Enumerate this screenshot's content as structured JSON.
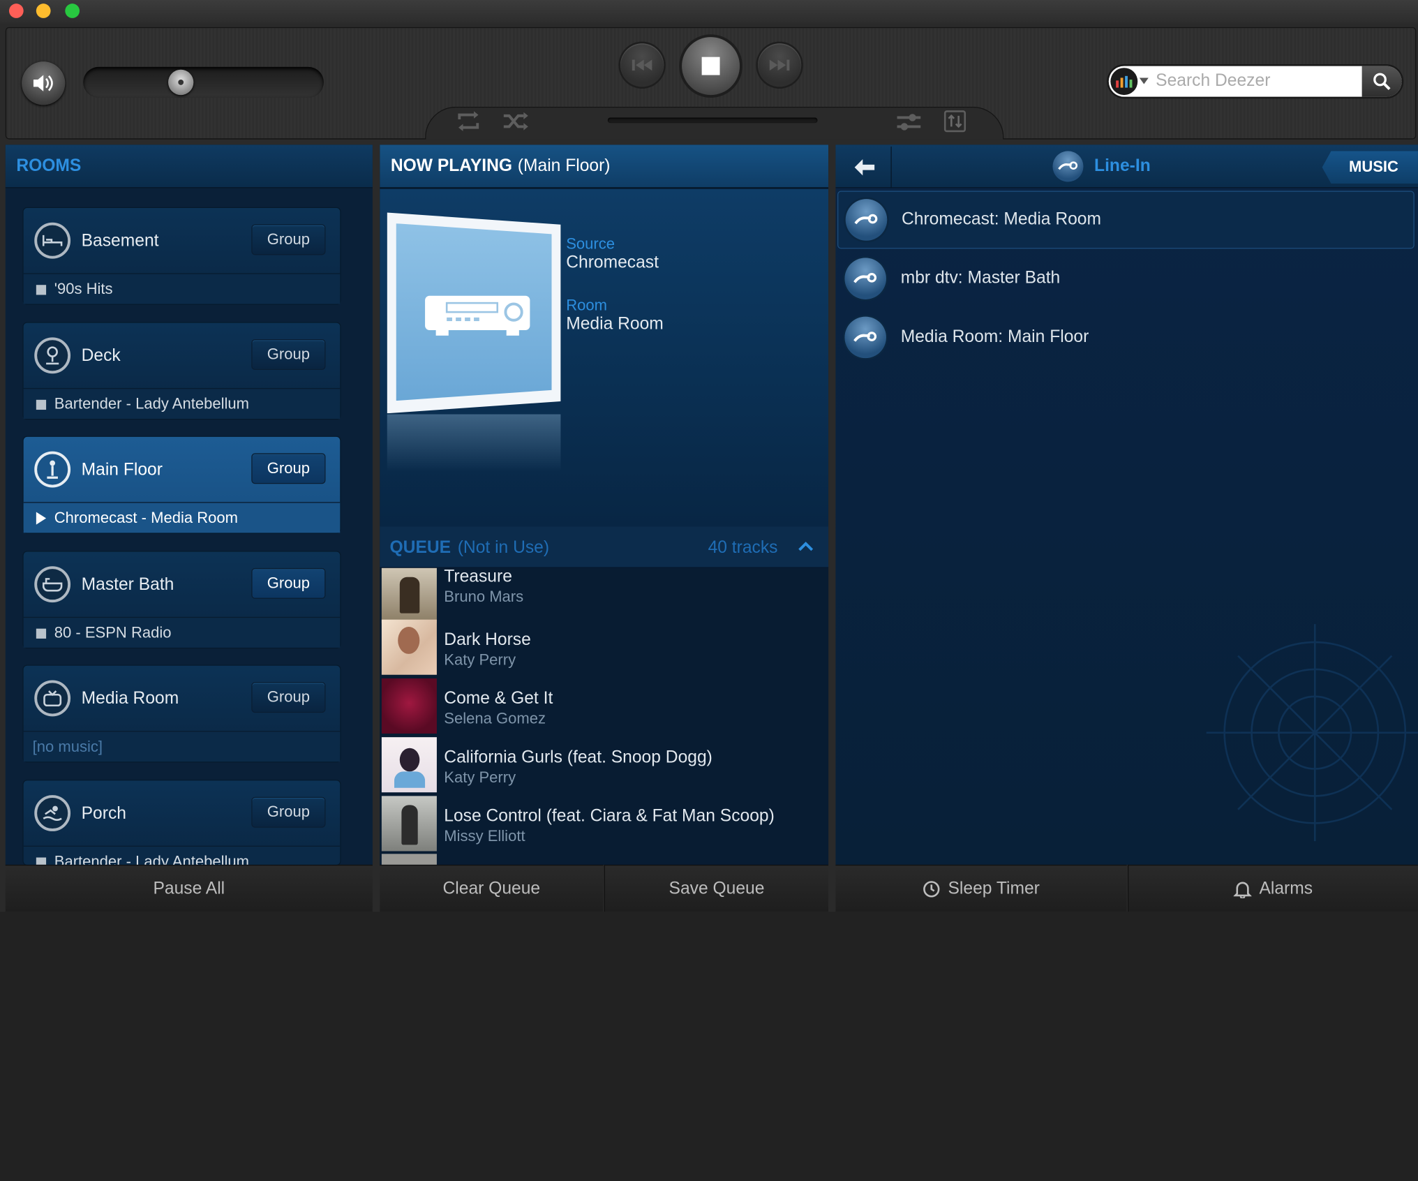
{
  "search": {
    "placeholder": "Search Deezer"
  },
  "rooms_panel": {
    "title": "ROOMS",
    "group_label": "Group",
    "rooms": [
      {
        "name": "Basement",
        "playing": "'90s Hits",
        "state": "stopped"
      },
      {
        "name": "Deck",
        "playing": "Bartender - Lady Antebellum",
        "state": "stopped"
      },
      {
        "name": "Main Floor",
        "playing": "Chromecast - Media Room",
        "state": "playing"
      },
      {
        "name": "Master Bath",
        "playing": "80 - ESPN Radio",
        "state": "stopped"
      },
      {
        "name": "Media Room",
        "playing": "[no music]",
        "state": "none"
      },
      {
        "name": "Porch",
        "playing": "Bartender - Lady Antebellum",
        "state": "stopped"
      }
    ],
    "pause_all": "Pause All"
  },
  "now_playing": {
    "title": "NOW PLAYING",
    "room": "(Main Floor)",
    "source_label": "Source",
    "source_value": "Chromecast",
    "room_label": "Room",
    "room_value": "Media Room"
  },
  "queue": {
    "title": "QUEUE",
    "status": "(Not in Use)",
    "count": "40 tracks",
    "tracks": [
      {
        "title": "Treasure",
        "artist": "Bruno Mars"
      },
      {
        "title": "Dark Horse",
        "artist": "Katy Perry"
      },
      {
        "title": "Come & Get It",
        "artist": "Selena Gomez"
      },
      {
        "title": "California Gurls (feat. Snoop Dogg)",
        "artist": "Katy Perry"
      },
      {
        "title": "Lose Control (feat. Ciara & Fat Man Scoop)",
        "artist": "Missy Elliott"
      }
    ],
    "clear": "Clear Queue",
    "save": "Save Queue"
  },
  "music_panel": {
    "title": "Line-In",
    "music_tab": "MUSIC",
    "items": [
      "Chromecast: Media Room",
      "mbr dtv: Master Bath",
      "Media Room: Main Floor"
    ],
    "sleep_timer": "Sleep Timer",
    "alarms": "Alarms"
  },
  "colors": {
    "accent": "#2d8fe0",
    "panel": "#0a2038"
  }
}
